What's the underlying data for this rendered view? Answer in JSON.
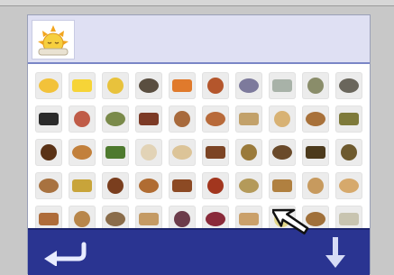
{
  "header": {
    "selected_icon": "sleeping-sun-icon"
  },
  "grid": {
    "rows": [
      [
        "sleeping-sun-icon",
        "sun-icon",
        "crescent-moon-icon",
        "cow-icon",
        "orange-icon",
        "small-fruit-icon",
        "bird-flowers-icon",
        "sardines-icon",
        "lizard-icon",
        "goat-icon"
      ],
      [
        "raven-icon",
        "pretzel-icon",
        "vegetable-bowl-icon",
        "salad-icon",
        "loaves-icon",
        "wheat-bundle-icon",
        "stick-icon",
        "bread-loaf-icon",
        "sliced-bread-icon",
        "cabbage-icon"
      ],
      [
        "curved-horn-icon",
        "pastry-ring-icon",
        "greens-icon",
        "plate-icon",
        "cracker-icon",
        "meat-chunks-icon",
        "grain-pile-icon",
        "dried-fish-icon",
        "dark-leaf-icon",
        "dried-herb-icon"
      ],
      [
        "small-loaves-icon",
        "fruit-pile-icon",
        "meat-pieces-icon",
        "roast-drumstick-icon",
        "roast-bird-icon",
        "meat-platter-icon",
        "grain-sack-icon",
        "bread-basket-icon",
        "bagel-icon",
        "round-bun-icon"
      ],
      [
        "bread-slices-icon",
        "rolls-icon",
        "round-loaf-icon",
        "baguette-icon",
        "grape-bunch-icon",
        "berries-icon",
        "pasta-icon",
        "flowers-icon",
        "loaf-pair-icon",
        "dumpling-icon"
      ]
    ],
    "colors": [
      [
        "#f2c23a",
        "#f6d437",
        "#e8c23c",
        "#5a4e40",
        "#e07a2c",
        "#b4562c",
        "#7d7a9c",
        "#a8b2a8",
        "#8a8d6a",
        "#6a665c"
      ],
      [
        "#2a2a2a",
        "#c05c48",
        "#7a8a4a",
        "#7c3a26",
        "#a86a3c",
        "#b86a3a",
        "#c2a16a",
        "#d8b274",
        "#a8713a",
        "#7e7a3a"
      ],
      [
        "#5a3216",
        "#c2803c",
        "#4e7a2e",
        "#e2d3b6",
        "#dcc498",
        "#7c4424",
        "#9a7a3a",
        "#6a4a2a",
        "#4c3a1c",
        "#6e5a2e"
      ],
      [
        "#a87240",
        "#c8a43a",
        "#7a3e1e",
        "#b06c32",
        "#8c4a24",
        "#a2361e",
        "#b49a5a",
        "#b08040",
        "#c79a5e",
        "#d6a96c"
      ],
      [
        "#ae6c3a",
        "#b8864a",
        "#8a6c4a",
        "#c49a64",
        "#6c3c4a",
        "#8a2a3a",
        "#caa06a",
        "#e2d68a",
        "#a0703a",
        "#c8c4b0"
      ]
    ]
  },
  "nav": {
    "back_icon": "back-arrow-icon",
    "down_icon": "down-arrow-icon"
  },
  "cursor": {
    "icon": "pointer-arrow-icon"
  }
}
